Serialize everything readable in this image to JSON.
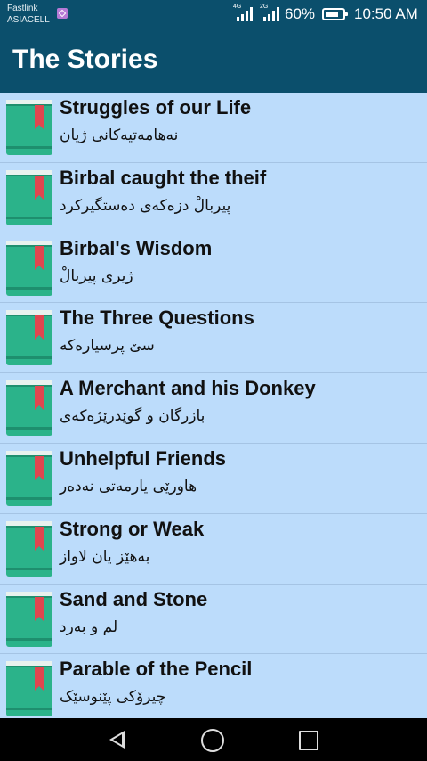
{
  "status": {
    "carrier1": "Fastlink",
    "carrier2": "ASIACELL",
    "net1": "4G",
    "net2": "2G",
    "battery_pct": "60%",
    "time": "10:50 AM"
  },
  "appbar": {
    "title": "The Stories"
  },
  "stories": [
    {
      "title": "Struggles of our Life",
      "subtitle": "نەهامەتیەکانی ژیان"
    },
    {
      "title": "Birbal caught the theif",
      "subtitle": "پیربالْ دزەکەی دەستگیرکرد"
    },
    {
      "title": "Birbal's Wisdom",
      "subtitle": "ژیری پیربالْ"
    },
    {
      "title": "The Three Questions",
      "subtitle": "سێ پرسیارەکە"
    },
    {
      "title": "A Merchant and his Donkey",
      "subtitle": "بازرگان و گوێدرێژەکەی"
    },
    {
      "title": "Unhelpful Friends",
      "subtitle": "هاورێی یارمەتی نەدەر"
    },
    {
      "title": "Strong or Weak",
      "subtitle": "بەهێز یان لاواز"
    },
    {
      "title": "Sand and Stone",
      "subtitle": "لم و بەرد"
    },
    {
      "title": "Parable of the Pencil",
      "subtitle": "چیرۆکی پێنوسێک"
    }
  ],
  "colors": {
    "appbar": "#0b4f6c",
    "list_bg": "#bcdcfb",
    "book_green": "#2bb38a",
    "bookmark_red": "#e0464f"
  }
}
